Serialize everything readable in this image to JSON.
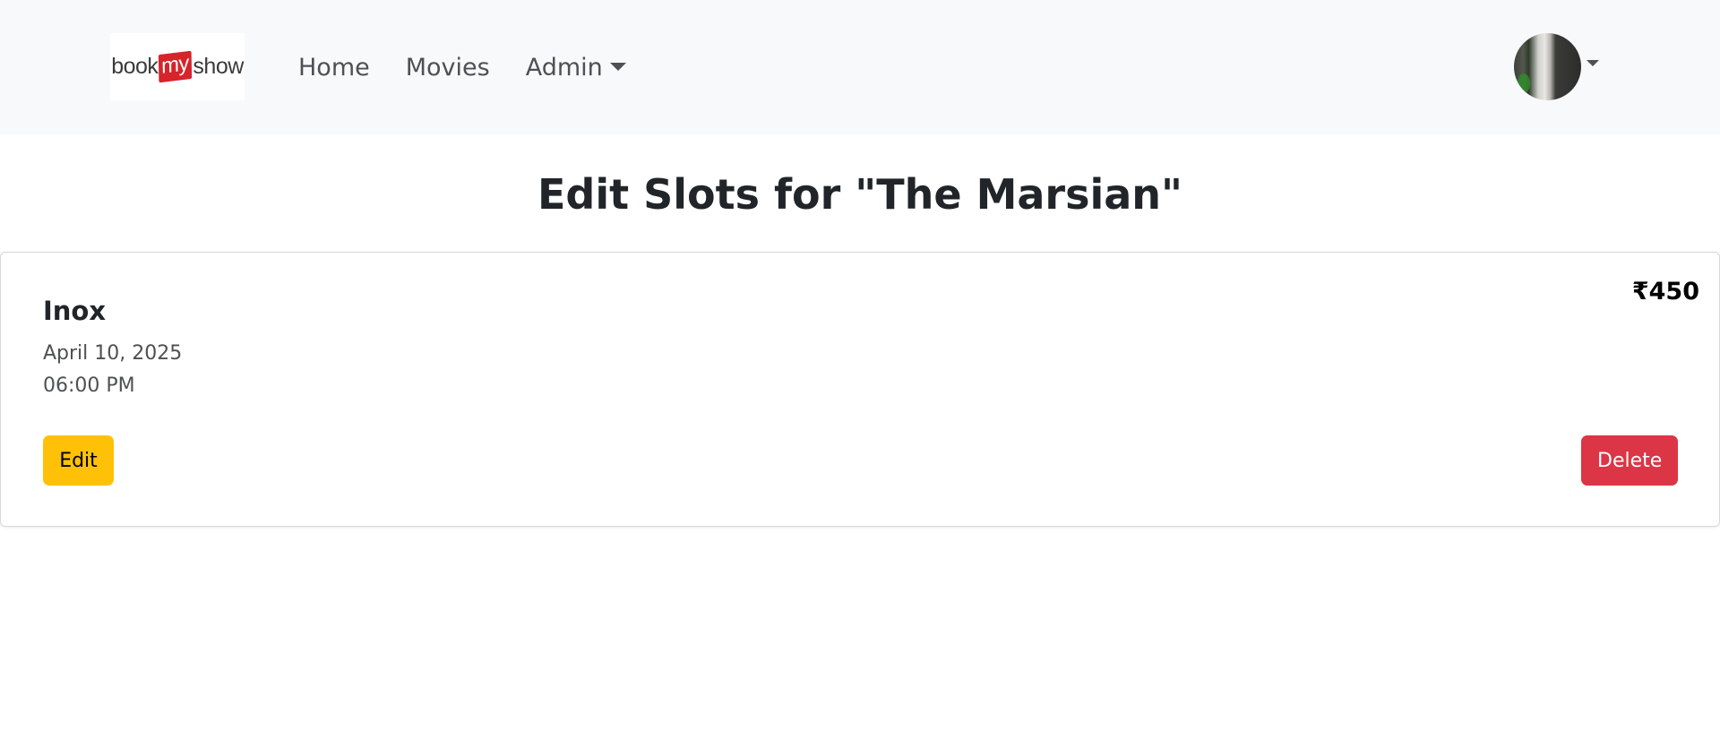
{
  "brand": {
    "part1": "book",
    "part2": "my",
    "part3": "show"
  },
  "nav": {
    "home": "Home",
    "movies": "Movies",
    "admin": "Admin"
  },
  "page": {
    "title": "Edit Slots for \"The Marsian\""
  },
  "slots": [
    {
      "theatre": "Inox",
      "date": "April 10, 2025",
      "time": "06:00 PM",
      "price": "₹450",
      "edit_label": "Edit",
      "delete_label": "Delete"
    }
  ],
  "colors": {
    "navbar_bg": "#f8f9fa",
    "edit_button": "#ffc107",
    "delete_button": "#dc3545",
    "brand_red": "#d6242a"
  },
  "icons": {
    "admin_dropdown": "chevron-down-icon",
    "user_dropdown": "chevron-down-icon"
  }
}
